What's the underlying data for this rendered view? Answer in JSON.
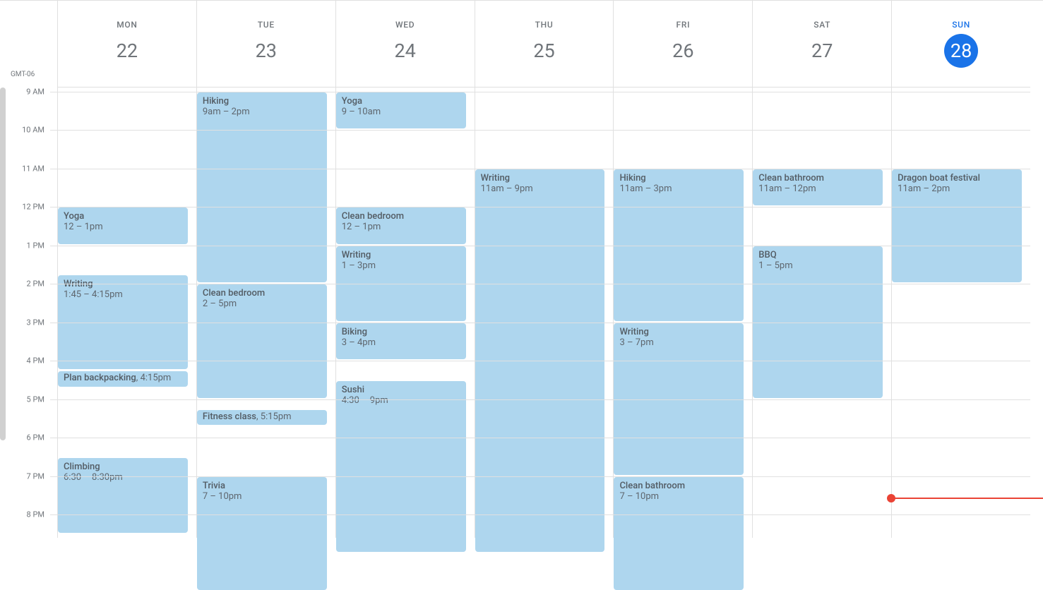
{
  "timezone": "GMT-06",
  "hourHeight": 54.5,
  "gridStartHour": 8.89,
  "nowHour": 19.55,
  "nowDayIndex": 6,
  "days": [
    {
      "dow": "MON",
      "num": "22",
      "today": false
    },
    {
      "dow": "TUE",
      "num": "23",
      "today": false
    },
    {
      "dow": "WED",
      "num": "24",
      "today": false
    },
    {
      "dow": "THU",
      "num": "25",
      "today": false
    },
    {
      "dow": "FRI",
      "num": "26",
      "today": false
    },
    {
      "dow": "SAT",
      "num": "27",
      "today": false
    },
    {
      "dow": "SUN",
      "num": "28",
      "today": true
    }
  ],
  "hourLabels": [
    {
      "hour": 9,
      "label": "9 AM"
    },
    {
      "hour": 10,
      "label": "10 AM"
    },
    {
      "hour": 11,
      "label": "11 AM"
    },
    {
      "hour": 12,
      "label": "12 PM"
    },
    {
      "hour": 13,
      "label": "1 PM"
    },
    {
      "hour": 14,
      "label": "2 PM"
    },
    {
      "hour": 15,
      "label": "3 PM"
    },
    {
      "hour": 16,
      "label": "4 PM"
    },
    {
      "hour": 17,
      "label": "5 PM"
    },
    {
      "hour": 18,
      "label": "6 PM"
    },
    {
      "hour": 19,
      "label": "7 PM"
    },
    {
      "hour": 20,
      "label": "8 PM"
    }
  ],
  "events": [
    {
      "day": 0,
      "title": "Yoga",
      "time": "12 – 1pm",
      "start": 12,
      "end": 13,
      "inline": false
    },
    {
      "day": 0,
      "title": "Writing",
      "time": "1:45 – 4:15pm",
      "start": 13.75,
      "end": 16.25,
      "inline": false
    },
    {
      "day": 0,
      "title": "Plan backpacking",
      "time": "4:15pm",
      "start": 16.25,
      "end": 16.7,
      "inline": true
    },
    {
      "day": 0,
      "title": "Climbing",
      "time": "6:30 – 8:30pm",
      "start": 18.5,
      "end": 20.5,
      "inline": false
    },
    {
      "day": 1,
      "title": "Hiking",
      "time": "9am – 2pm",
      "start": 9,
      "end": 14,
      "inline": false
    },
    {
      "day": 1,
      "title": "Clean bedroom",
      "time": "2 – 5pm",
      "start": 14,
      "end": 17,
      "inline": false
    },
    {
      "day": 1,
      "title": "Fitness class",
      "time": "5:15pm",
      "start": 17.25,
      "end": 17.7,
      "inline": true
    },
    {
      "day": 1,
      "title": "Trivia",
      "time": "7 – 10pm",
      "start": 19,
      "end": 22,
      "inline": false
    },
    {
      "day": 2,
      "title": "Yoga",
      "time": "9 – 10am",
      "start": 9,
      "end": 10,
      "inline": false
    },
    {
      "day": 2,
      "title": "Clean bedroom",
      "time": "12 – 1pm",
      "start": 12,
      "end": 13,
      "inline": false
    },
    {
      "day": 2,
      "title": "Writing",
      "time": "1 – 3pm",
      "start": 13,
      "end": 15,
      "inline": false
    },
    {
      "day": 2,
      "title": "Biking",
      "time": "3 – 4pm",
      "start": 15,
      "end": 16,
      "inline": false
    },
    {
      "day": 2,
      "title": "Sushi",
      "time": "4:30 – 9pm",
      "start": 16.5,
      "end": 21,
      "inline": false
    },
    {
      "day": 3,
      "title": "Writing",
      "time": "11am – 9pm",
      "start": 11,
      "end": 21,
      "inline": false
    },
    {
      "day": 4,
      "title": "Hiking",
      "time": "11am – 3pm",
      "start": 11,
      "end": 15,
      "inline": false
    },
    {
      "day": 4,
      "title": "Writing",
      "time": "3 – 7pm",
      "start": 15,
      "end": 19,
      "inline": false
    },
    {
      "day": 4,
      "title": "Clean bathroom",
      "time": "7 – 10pm",
      "start": 19,
      "end": 22,
      "inline": false
    },
    {
      "day": 5,
      "title": "Clean bathroom",
      "time": "11am – 12pm",
      "start": 11,
      "end": 12,
      "inline": false
    },
    {
      "day": 5,
      "title": "BBQ",
      "time": "1 – 5pm",
      "start": 13,
      "end": 17,
      "inline": false
    },
    {
      "day": 6,
      "title": "Dragon boat festival",
      "time": "11am – 2pm",
      "start": 11,
      "end": 14,
      "inline": false
    }
  ]
}
